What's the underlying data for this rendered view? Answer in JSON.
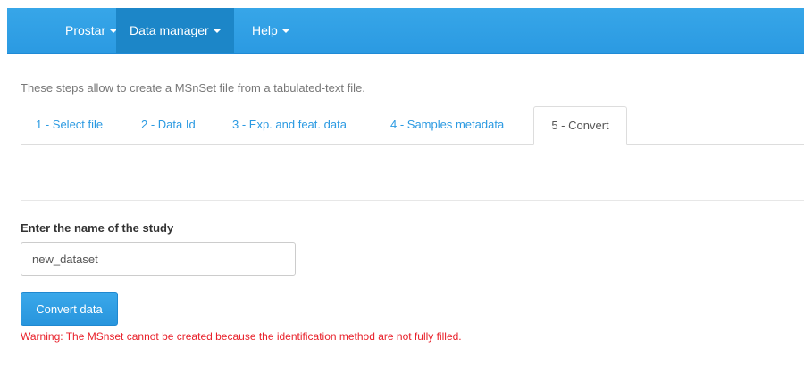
{
  "navbar": {
    "items": [
      {
        "label": "Prostar",
        "dropdown": true
      },
      {
        "label": "Data manager",
        "dropdown": true,
        "active": true
      },
      {
        "label": "Help",
        "dropdown": true
      }
    ],
    "color": "#2b9ae2",
    "active_color": "#1c86c8"
  },
  "intro_text": "These steps allow to create a MSnSet file from a tabulated-text file.",
  "tabs": [
    {
      "label": "1 - Select file"
    },
    {
      "label": "2 - Data Id"
    },
    {
      "label": "3 - Exp. and feat. data"
    },
    {
      "label": "4 - Samples metadata"
    },
    {
      "label": "5 - Convert",
      "active": true
    }
  ],
  "study_form": {
    "label": "Enter the name of the study",
    "value": "new_dataset"
  },
  "convert_button": {
    "label": "Convert data"
  },
  "warning": {
    "text": "Warning: The MSnset cannot be created because the identification method are not fully filled.",
    "color": "#e8202a"
  }
}
